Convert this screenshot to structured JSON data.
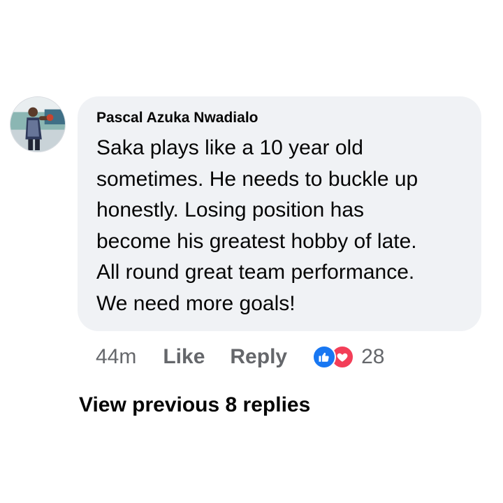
{
  "comment": {
    "author": "Pascal Azuka Nwadialo",
    "lines": [
      "Saka plays like a 10 year old",
      "sometimes. He needs to buckle up",
      "honestly. Losing position has",
      "become his greatest hobby of late.",
      "All round great team performance.",
      "We need more goals!"
    ],
    "avatar_icon": "profile-photo"
  },
  "actions": {
    "time": "44m",
    "like_label": "Like",
    "reply_label": "Reply",
    "reaction_icons": [
      "like-icon",
      "love-icon"
    ],
    "reaction_count": "28"
  },
  "replies": {
    "view_previous_label": "View previous 8 replies"
  },
  "colors": {
    "bubble_bg": "#f0f2f5",
    "text_primary": "#050505",
    "text_secondary": "#65676b",
    "like_blue": "#1877f2",
    "love_red": "#f33e58"
  }
}
